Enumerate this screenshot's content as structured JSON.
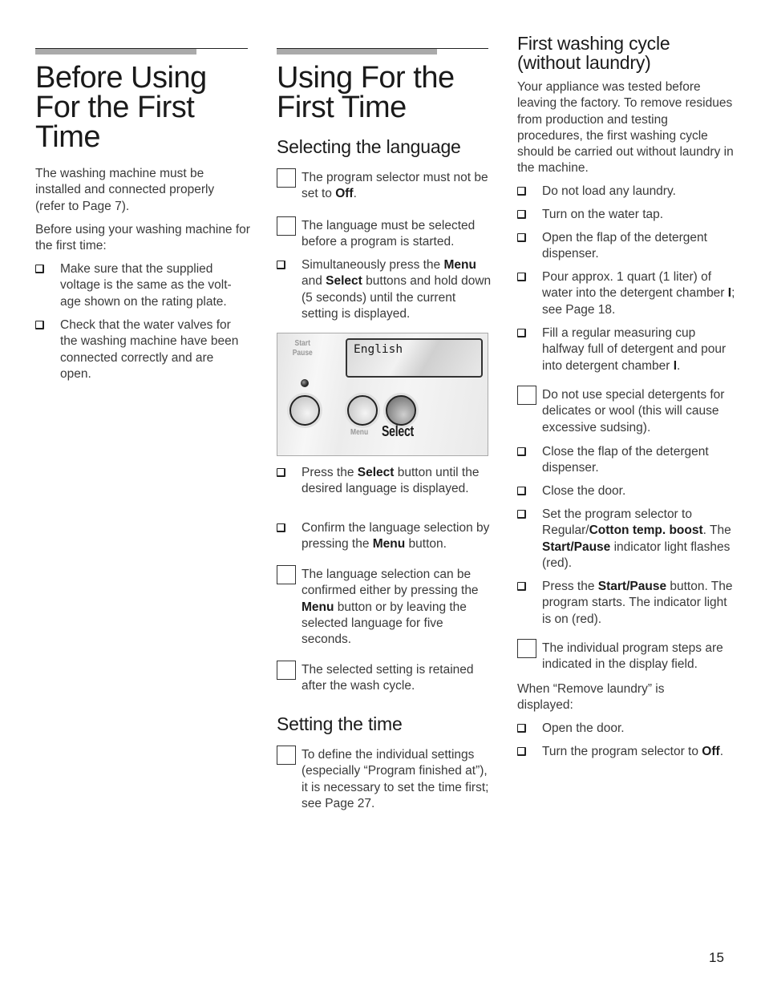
{
  "page_number": "15",
  "column1": {
    "title_lines": [
      "Before Using",
      "For the First",
      "Time"
    ],
    "intro": "The washing machine must be installed and connected properly (refer to Page 7).",
    "lead": "Before using your washing machine for the first time:",
    "items": [
      {
        "type": "bullet",
        "text": "Make sure that the supplied voltage is the same as the volt-age shown on the rating plate."
      },
      {
        "type": "bullet",
        "text": "Check that the water valves for the washing machine have been connected correctly and are open."
      }
    ]
  },
  "column2": {
    "title_lines": [
      "Using For the",
      "First Time"
    ],
    "section1_heading": "Selecting the language",
    "section1_items": [
      {
        "type": "note",
        "parts": [
          "The program selector must not be set to ",
          "Off",
          "."
        ]
      },
      {
        "type": "note",
        "parts": [
          "The language must be selected before a program is started."
        ]
      },
      {
        "type": "bullet",
        "parts": [
          "Simultaneously press the ",
          "Menu",
          " and ",
          "Select",
          " buttons and hold down (5 seconds) until the current setting is displayed."
        ]
      }
    ],
    "panel": {
      "start_pause_label": [
        "Start",
        "Pause"
      ],
      "display_text": "English",
      "menu_label": "Menu",
      "select_label": "Select"
    },
    "section1_items_after": [
      {
        "type": "bullet",
        "parts": [
          "Press the ",
          "Select",
          " button until the desired language is displayed."
        ]
      },
      {
        "type": "bullet",
        "parts": [
          "Confirm the language selection by pressing the ",
          "Menu",
          " button."
        ]
      },
      {
        "type": "note",
        "parts": [
          "The language selection can be confirmed either by pressing the ",
          "Menu",
          " button or by leaving the selected language for five seconds."
        ]
      },
      {
        "type": "note",
        "parts": [
          "The selected setting is retained after the wash cycle."
        ]
      }
    ],
    "section2_heading": "Setting the time",
    "section2_items": [
      {
        "type": "note",
        "parts": [
          "To define the individual settings (especially “Program finished at”), it is necessary to set the time first; see Page  27."
        ]
      }
    ]
  },
  "column3": {
    "heading_lines": [
      "First washing cycle",
      "(without laundry)"
    ],
    "intro": "Your appliance was tested before leaving the factory. To remove residues from production and testing procedures, the first washing cycle should be carried out without laundry in the machine.",
    "items": [
      {
        "type": "bullet",
        "parts": [
          "Do not load any laundry."
        ]
      },
      {
        "type": "bullet",
        "parts": [
          "Turn on the water tap."
        ]
      },
      {
        "type": "bullet",
        "parts": [
          "Open the flap of the detergent dispenser."
        ]
      },
      {
        "type": "bullet",
        "parts": [
          "Pour approx. 1 quart (1 liter) of water into the detergent chamber ",
          "I",
          "; see Page 18."
        ]
      },
      {
        "type": "bullet",
        "parts": [
          "Fill a regular measuring cup halfway full of detergent and pour into detergent chamber ",
          "I",
          "."
        ]
      },
      {
        "type": "note",
        "parts": [
          "Do not use special detergents for delicates or wool (this will cause excessive sudsing)."
        ]
      },
      {
        "type": "bullet",
        "parts": [
          "Close the flap of the detergent dispenser."
        ]
      },
      {
        "type": "bullet",
        "parts": [
          "Close the door."
        ]
      },
      {
        "type": "bullet",
        "parts": [
          "Set the program selector to Regular/",
          "Cotton temp. boost",
          ". The ",
          "Start/Pause",
          " indicator light flashes (red)."
        ]
      },
      {
        "type": "bullet",
        "parts": [
          "Press the ",
          "Start/Pause",
          " button. The program starts. The indicator light is on (red)."
        ]
      },
      {
        "type": "note",
        "parts": [
          "The individual program steps are indicated in the display field."
        ]
      }
    ],
    "when_text": "When “Remove laundry” is displayed:",
    "final_items": [
      {
        "type": "bullet",
        "parts": [
          "Open the door."
        ]
      },
      {
        "type": "bullet",
        "parts": [
          "Turn the program selector to ",
          "Off",
          "."
        ]
      }
    ]
  }
}
